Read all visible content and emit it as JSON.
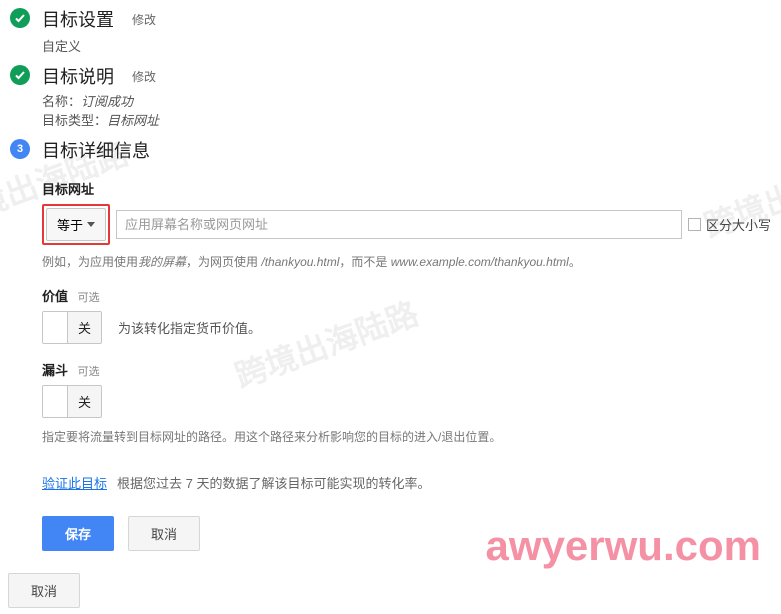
{
  "watermark": {
    "url": "awyerwu.com"
  },
  "steps": {
    "setup": {
      "title": "目标设置",
      "edit": "修改",
      "sub": "自定义"
    },
    "desc": {
      "title": "目标说明",
      "edit": "修改",
      "name_label": "名称：",
      "name_value": "订阅成功",
      "type_label": "目标类型：",
      "type_value": "目标网址"
    },
    "detail": {
      "number": "3",
      "title": "目标详细信息"
    }
  },
  "dest": {
    "label": "目标网址",
    "match_mode": "等于",
    "placeholder": "应用屏幕名称或网页网址",
    "case_label": "区分大小写",
    "hint_prefix": "例如，为应用使用",
    "hint_em1": "我的屏幕",
    "hint_mid": "，为网页使用 ",
    "hint_path": "/thankyou.html",
    "hint_mid2": "，而不是 ",
    "hint_em2": "www.example.com/thankyou.html",
    "hint_suffix": "。"
  },
  "value": {
    "label": "价值",
    "optional": "可选",
    "toggle_on": "",
    "toggle_off": "关",
    "desc": "为该转化指定货币价值。"
  },
  "funnel": {
    "label": "漏斗",
    "optional": "可选",
    "toggle_on": "",
    "toggle_off": "关",
    "desc": "指定要将流量转到目标网址的路径。用这个路径来分析影响您的目标的进入/退出位置。"
  },
  "verify": {
    "link": "验证此目标",
    "desc": "根据您过去 7 天的数据了解该目标可能实现的转化率。"
  },
  "buttons": {
    "save": "保存",
    "cancel": "取消",
    "cancel_outer": "取消"
  }
}
